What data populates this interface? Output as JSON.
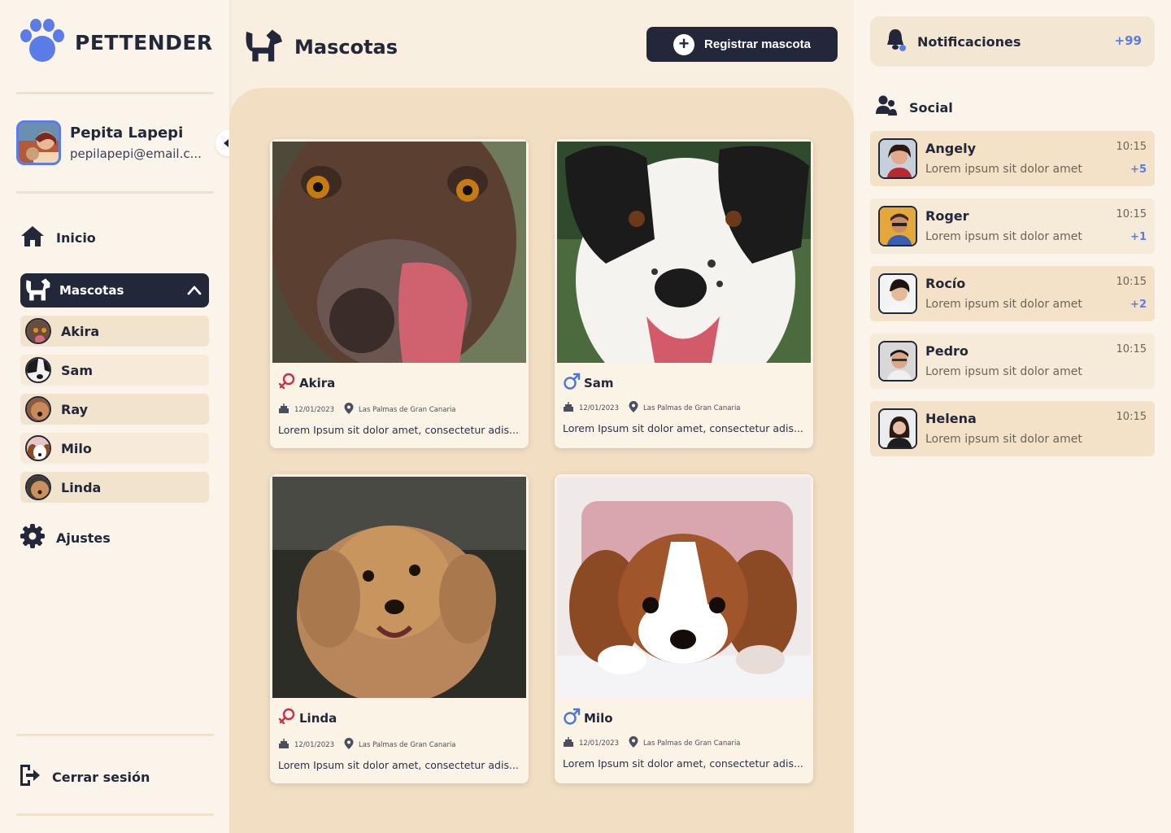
{
  "app": {
    "name": "PETTENDER"
  },
  "user": {
    "name": "Pepita Lapepi",
    "email": "pepilapepi@email.c..."
  },
  "nav": {
    "home": "Inicio",
    "pets": "Mascotas",
    "settings": "Ajustes",
    "logout": "Cerrar sesión",
    "pet_items": [
      {
        "label": "Akira"
      },
      {
        "label": "Sam"
      },
      {
        "label": "Ray"
      },
      {
        "label": "Milo"
      },
      {
        "label": "Linda"
      }
    ]
  },
  "main": {
    "title": "Mascotas",
    "register_button": "Registrar mascota",
    "cards": [
      {
        "name": "Akira",
        "sex": "female",
        "date": "12/01/2023",
        "location": "Las Palmas de Gran Canaria",
        "desc": "Lorem Ipsum sit dolor amet, consectetur adis..."
      },
      {
        "name": "Sam",
        "sex": "male",
        "date": "12/01/2023",
        "location": "Las Palmas de Gran Canaria",
        "desc": "Lorem Ipsum sit dolor amet, consectetur adis..."
      },
      {
        "name": "Linda",
        "sex": "female",
        "date": "12/01/2023",
        "location": "Las Palmas de Gran Canaria",
        "desc": "Lorem Ipsum sit dolor amet, consectetur adis..."
      },
      {
        "name": "Milo",
        "sex": "male",
        "date": "12/01/2023",
        "location": "Las Palmas de Gran Canaria",
        "desc": "Lorem Ipsum sit dolor amet, consectetur adis..."
      }
    ]
  },
  "notifications": {
    "label": "Notificaciones",
    "count": "+99"
  },
  "social": {
    "title": "Social",
    "chats": [
      {
        "name": "Angely",
        "msg": "Lorem ipsum sit dolor amet",
        "time": "10:15",
        "badge": "+5"
      },
      {
        "name": "Roger",
        "msg": "Lorem ipsum sit dolor amet",
        "time": "10:15",
        "badge": "+1"
      },
      {
        "name": "Rocío",
        "msg": "Lorem ipsum sit dolor amet",
        "time": "10:15",
        "badge": "+2"
      },
      {
        "name": "Pedro",
        "msg": "Lorem ipsum sit dolor amet",
        "time": "10:15",
        "badge": ""
      },
      {
        "name": "Helena",
        "msg": "Lorem ipsum sit dolor amet",
        "time": "10:15",
        "badge": ""
      }
    ]
  },
  "colors": {
    "dark": "#22273a",
    "accent": "#5b7ce6",
    "female": "#d22b4b",
    "male": "#4a76d6",
    "cream": "#fbf4ea",
    "tan": "#f2dec3"
  },
  "icons": [
    "paw-icon",
    "home-icon",
    "dog-icon",
    "chevron-up-icon",
    "gear-icon",
    "logout-icon",
    "plus-icon",
    "bell-icon",
    "users-icon",
    "female-icon",
    "male-icon",
    "cake-icon",
    "location-pin-icon"
  ]
}
